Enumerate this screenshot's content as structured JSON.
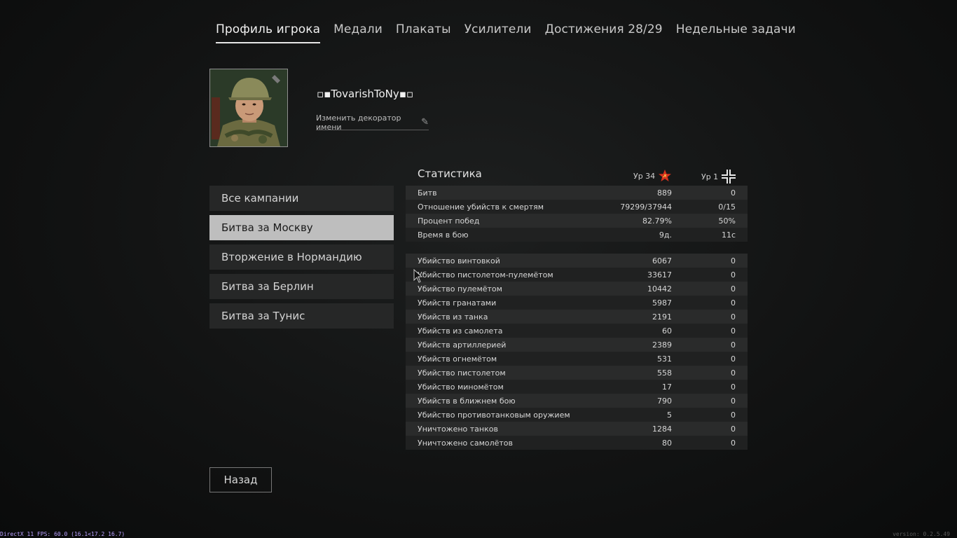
{
  "tabs": [
    {
      "label": "Профиль игрока",
      "active": true
    },
    {
      "label": "Медали"
    },
    {
      "label": "Плакаты"
    },
    {
      "label": "Усилители"
    },
    {
      "label": "Достижения 28/29"
    },
    {
      "label": "Недельные задачи"
    }
  ],
  "profile": {
    "player_name": "▫▪TovarishToNy▪▫",
    "change_decorator_label": "Изменить декоратор имени",
    "avatar_icon": "soldier-portrait",
    "edit_icon": "pencil-icon"
  },
  "campaigns": [
    {
      "label": "Все кампании"
    },
    {
      "label": "Битва за Москву",
      "active": true
    },
    {
      "label": "Вторжение в Нормандию"
    },
    {
      "label": "Битва за Берлин"
    },
    {
      "label": "Битва за Тунис"
    }
  ],
  "stats": {
    "title": "Статистика",
    "level_allies": "Ур 34",
    "level_axis": "Ур 1",
    "allies_icon": "soviet-star-icon",
    "axis_icon": "iron-cross-icon",
    "general": [
      {
        "label": "Битв",
        "v1": "889",
        "v2": "0"
      },
      {
        "label": "Отношение убийств к смертям",
        "v1": "79299/37944",
        "v2": "0/15"
      },
      {
        "label": "Процент побед",
        "v1": "82.79%",
        "v2": "50%"
      },
      {
        "label": "Время в бою",
        "v1": "9д.",
        "v2": "11с"
      }
    ],
    "kills": [
      {
        "label": "Убийство винтовкой",
        "v1": "6067",
        "v2": "0"
      },
      {
        "label": "Убийство пистолетом-пулемётом",
        "v1": "33617",
        "v2": "0"
      },
      {
        "label": "Убийство пулемётом",
        "v1": "10442",
        "v2": "0"
      },
      {
        "label": "Убийств гранатами",
        "v1": "5987",
        "v2": "0"
      },
      {
        "label": "Убийств из танка",
        "v1": "2191",
        "v2": "0"
      },
      {
        "label": "Убийств из самолета",
        "v1": "60",
        "v2": "0"
      },
      {
        "label": "Убийств артиллерией",
        "v1": "2389",
        "v2": "0"
      },
      {
        "label": "Убийств огнемётом",
        "v1": "531",
        "v2": "0"
      },
      {
        "label": "Убийство пистолетом",
        "v1": "558",
        "v2": "0"
      },
      {
        "label": "Убийство миномётом",
        "v1": "17",
        "v2": "0"
      },
      {
        "label": "Убийств в ближнем бою",
        "v1": "790",
        "v2": "0"
      },
      {
        "label": "Убийство противотанковым оружием",
        "v1": "5",
        "v2": "0"
      },
      {
        "label": "Уничтожено танков",
        "v1": "1284",
        "v2": "0"
      },
      {
        "label": "Уничтожено самолётов",
        "v1": "80",
        "v2": "0"
      }
    ]
  },
  "back_label": "Назад",
  "debug_text": "DirectX 11 FPS: 60.0 (16.1<17.2 16.7)",
  "version_text": "version: 0.2.5.49"
}
